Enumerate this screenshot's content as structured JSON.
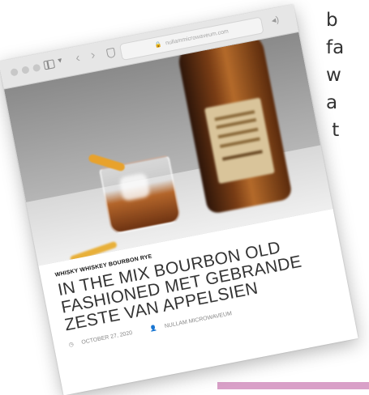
{
  "background_text": "b\nfa\nw\na\n t",
  "browser": {
    "url": "nullammicrowaveum.com",
    "lock_icon": "🔒"
  },
  "article": {
    "categories": "WHISKY WHISKEY BOURBON RYE",
    "title": "IN THE MIX BOURBON OLD FASHIONED MET GEBRANDE ZESTE VAN APPELSIEN",
    "date": "OCTOBER 27, 2020",
    "author": "NULLAM MICROWAVEUM",
    "clock_icon": "◷",
    "user_icon": "👤"
  },
  "colors": {
    "accent_bar": "#d9a0c8",
    "chrome": "#e6e6e6"
  }
}
